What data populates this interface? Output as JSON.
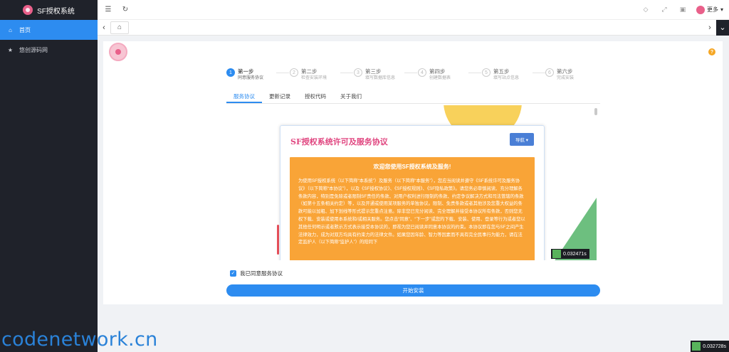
{
  "sidebar": {
    "brand": "SF授权系统",
    "items": [
      {
        "label": "首页",
        "icon": "home-icon"
      },
      {
        "label": "悠创源码网",
        "icon": "star-icon"
      }
    ]
  },
  "topbar": {
    "user_label": "更多"
  },
  "steps": [
    {
      "num": "1",
      "title": "第一步",
      "sub": "同意服务协议"
    },
    {
      "num": "2",
      "title": "第二步",
      "sub": "检查安装环境"
    },
    {
      "num": "3",
      "title": "第三步",
      "sub": "填写数据库信息"
    },
    {
      "num": "4",
      "title": "第四步",
      "sub": "创建数据表"
    },
    {
      "num": "5",
      "title": "第五步",
      "sub": "填写站点信息"
    },
    {
      "num": "6",
      "title": "第六步",
      "sub": "完成安装"
    }
  ],
  "tabs": [
    "服务协议",
    "更新记录",
    "授权代码",
    "关于我们"
  ],
  "agreement": {
    "title": "SF授权系统许可及服务协议",
    "nav_label": "导航 ▾",
    "heading": "欢迎您使用SF授权系统及服务!",
    "text": "为使用SF授权系统（以下简称“本系统”）及服务（以下简称“本服务”），您应当阅读并遵守《SF系统许可及服务协议》（以下简称“本协议”），以及《SF授权协议》、《SF授权规则》、《SF隐私政策》。请您务必审慎阅读、充分理解各条款内容，特别是免除或者限制SF责任的条款、对用户权利进行限制的条款、约定争议解决方式和司法管辖的条款（如第十五条相关约定）等，以及开通或使用某项服务的单独协议。限制、免责条款或者其他涉及您重大权益的条款可能以加粗、加下划线等形式提示您重点注意。除非您已充分阅读、完全理解并接受本协议所有条款，否则您无权下载、安装或使用本系统和/或相关服务。您点击“同意”、“下一步”或您的下载、安装、使用、登录等行为或者您以其他任何明示或者默示方式表示接受本协议的，即视为您已阅读并同意本协议的约束。本协议即在您与SF之间产生法律效力，成为对双方均具有约束力的法律文件。如果您因年龄、智力等因素而不具有完全民事行为能力，请在法定监护人（以下简称“监护人”）的陪同下"
  },
  "timers": {
    "inner": "0.032471s",
    "outer": "0.032728s"
  },
  "agree_label": "我已同意服务协议",
  "start_button": "开始安装",
  "watermark": "codenetwork.cn",
  "colors": {
    "primary": "#2d8cf0",
    "sidebar_bg": "#1f222a",
    "doc_orange": "#f9a437",
    "doc_title_pink": "#e0457f"
  }
}
